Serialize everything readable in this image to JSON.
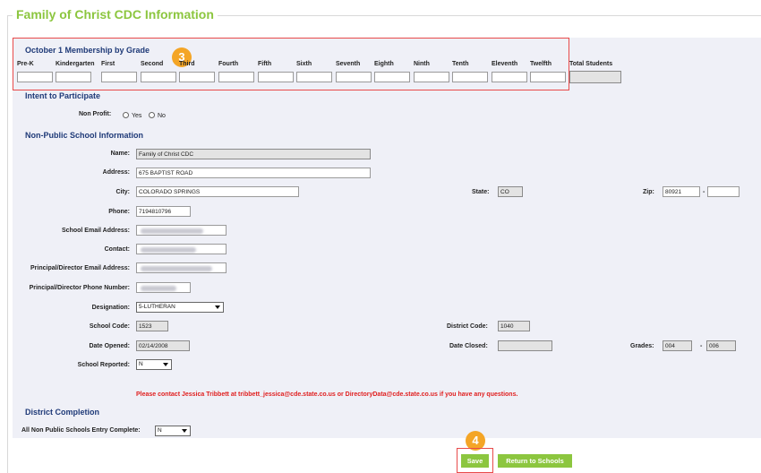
{
  "page": {
    "title": "Family of Christ CDC Information"
  },
  "membership": {
    "heading": "October 1 Membership by Grade",
    "grades": [
      "Pre-K",
      "Kindergarten",
      "First",
      "Second",
      "Third",
      "Fourth",
      "Fifth",
      "Sixth",
      "Seventh",
      "Eighth",
      "Ninth",
      "Tenth",
      "Eleventh",
      "Twelfth"
    ],
    "total_label": "Total Students",
    "badge": "3"
  },
  "intent": {
    "heading": "Intent to Participate",
    "nonprofit_label": "Non Profit:",
    "yes_label": "Yes",
    "no_label": "No"
  },
  "school": {
    "heading": "Non-Public School Information",
    "name_label": "Name:",
    "name_value": "Family of Christ CDC",
    "address_label": "Address:",
    "address_value": "675 BAPTIST ROAD",
    "city_label": "City:",
    "city_value": "COLORADO SPRINGS",
    "state_label": "State:",
    "state_value": "CO",
    "zip_label": "Zip:",
    "zip_value": "80921",
    "zip_sep": "-",
    "phone_label": "Phone:",
    "phone_value": "7194810796",
    "email_label": "School Email Address:",
    "contact_label": "Contact:",
    "principal_email_label": "Principal/Director Email Address:",
    "principal_phone_label": "Principal/Director Phone Number:",
    "designation_label": "Designation:",
    "designation_value": "5-LUTHERAN",
    "school_code_label": "School Code:",
    "school_code_value": "1523",
    "district_code_label": "District Code:",
    "district_code_value": "1040",
    "date_opened_label": "Date Opened:",
    "date_opened_value": "02/14/2008",
    "date_closed_label": "Date Closed:",
    "grades_label": "Grades:",
    "grade_from": "004",
    "grade_sep": "-",
    "grade_to": "006",
    "reported_label": "School Reported:",
    "reported_value": "N"
  },
  "contact_note": "Please contact Jessica Tribbett at tribbett_jessica@cde.state.co.us or DirectoryData@cde.state.co.us if you have any questions.",
  "district": {
    "heading": "District Completion",
    "complete_label": "All Non Public Schools Entry Complete:",
    "complete_value": "N"
  },
  "buttons": {
    "save": "Save",
    "return": "Return to Schools",
    "badge": "4"
  },
  "colors": {
    "accent": "#8cc63f",
    "heading": "#1f3a78",
    "highlight": "#e84a4a",
    "badge": "#f4a526",
    "note": "#e02020"
  }
}
